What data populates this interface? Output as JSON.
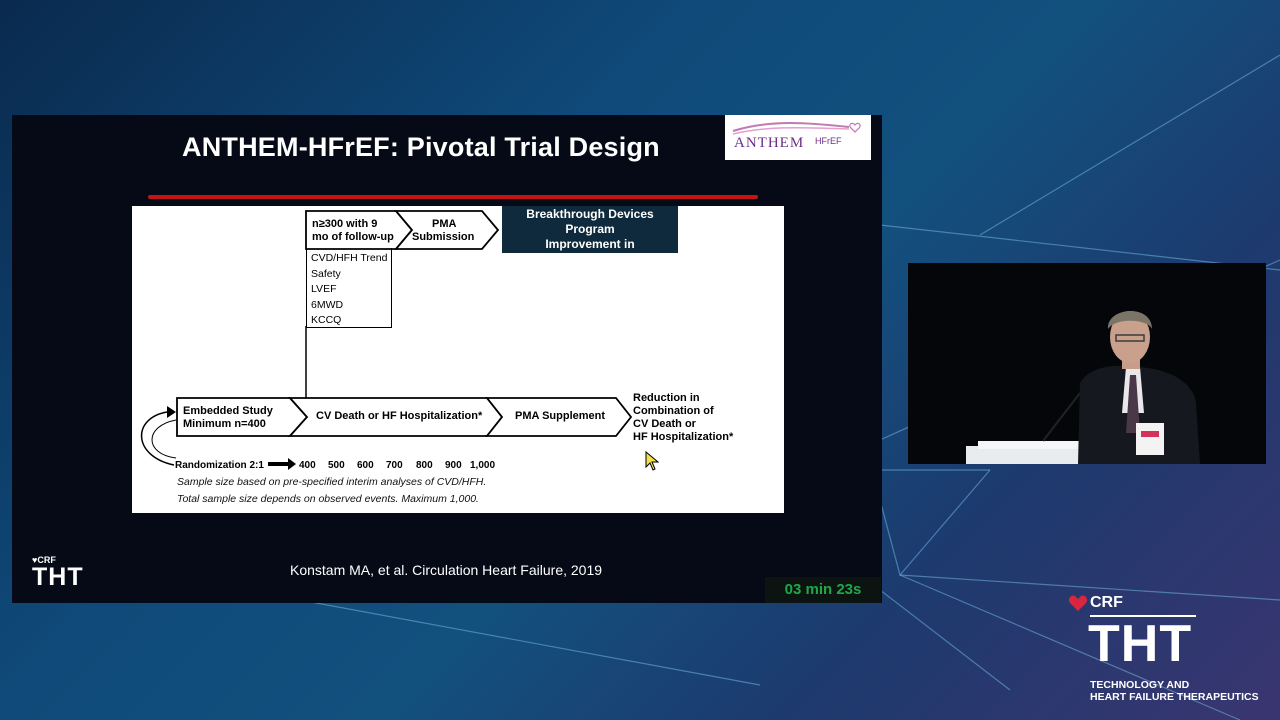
{
  "slide": {
    "title": "ANTHEM-HFrEF: Pivotal Trial Design",
    "logo_word": "ANTHEM",
    "logo_sub": "HFrEF",
    "citation": "Konstam MA, et al. Circulation Heart Failure, 2019",
    "timer": "03 min 23s",
    "corner_brand": {
      "crf": "CRF",
      "tht": "THT"
    }
  },
  "diagram": {
    "top_arrow": {
      "line1": "n≥300 with 9",
      "line2": "mo of follow-up"
    },
    "pma_submission": {
      "line1": "PMA",
      "line2": "Submission"
    },
    "btd": {
      "line1": "Breakthrough Devices",
      "line2": "Program",
      "line3": "Improvement in"
    },
    "endpoints": [
      "CVD/HFH Trend",
      "Safety",
      "LVEF",
      "6MWD",
      "KCCQ"
    ],
    "embedded_study": {
      "line1": "Embedded Study",
      "line2": "Minimum n=400"
    },
    "main_arrow": "CV Death or HF Hospitalization*",
    "pma_supplement": "PMA Supplement",
    "reduction": {
      "line1": "Reduction in",
      "line2": "Combination of",
      "line3": "CV Death or",
      "line4": "HF Hospitalization*"
    },
    "randomization": "Randomization 2:1",
    "sample_ticks": [
      "400",
      "500",
      "600",
      "700",
      "800",
      "900",
      "1,000"
    ],
    "footnote1": "Sample size based on pre-specified interim analyses of CVD/HFH.",
    "footnote2": "Total sample size depends on observed events.  Maximum 1,000."
  },
  "brand": {
    "crf": "CRF",
    "tht": "THT",
    "line1": "TECHNOLOGY AND",
    "line2": "HEART FAILURE THERAPEUTICS"
  },
  "colors": {
    "title_rule": "#c41414",
    "timer_text": "#1fa84a",
    "btd_box": "#0f2a3c",
    "logo_purple": "#6e2d86"
  }
}
